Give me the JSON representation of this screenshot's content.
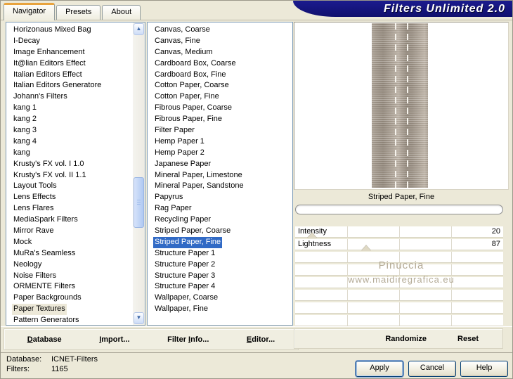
{
  "window_title": "Filters Unlimited 2.0",
  "tabs": [
    "Navigator",
    "Presets",
    "About"
  ],
  "active_tab": "Navigator",
  "category_list": {
    "selected": "Paper Textures",
    "items": [
      "Horizonaus Mixed Bag",
      "I-Decay",
      "Image Enhancement",
      "It@lian Editors Effect",
      "Italian Editors Effect",
      "Italian Editors Generatore",
      "Johann's Filters",
      "kang 1",
      "kang 2",
      "kang 3",
      "kang 4",
      "kang",
      "Krusty's FX vol. I 1.0",
      "Krusty's FX vol. II 1.1",
      "Layout Tools",
      "Lens Effects",
      "Lens Flares",
      "MediaSpark Filters",
      "Mirror Rave",
      "Mock",
      "MuRa's Seamless",
      "Neology",
      "Noise Filters",
      "ORMENTE Filters",
      "Paper Backgrounds",
      "Paper Textures",
      "Pattern Generators"
    ]
  },
  "filter_list": {
    "selected": "Striped Paper, Fine",
    "items": [
      "Canvas, Coarse",
      "Canvas, Fine",
      "Canvas, Medium",
      "Cardboard Box, Coarse",
      "Cardboard Box, Fine",
      "Cotton Paper, Coarse",
      "Cotton Paper, Fine",
      "Fibrous Paper, Coarse",
      "Fibrous Paper, Fine",
      "Filter Paper",
      "Hemp Paper 1",
      "Hemp Paper 2",
      "Japanese Paper",
      "Mineral Paper, Limestone",
      "Mineral Paper, Sandstone",
      "Papyrus",
      "Rag Paper",
      "Recycling Paper",
      "Striped Paper, Coarse",
      "Striped Paper, Fine",
      "Structure Paper 1",
      "Structure Paper 2",
      "Structure Paper 3",
      "Structure Paper 4",
      "Wallpaper, Coarse",
      "Wallpaper, Fine"
    ]
  },
  "preview": {
    "caption": "Striped Paper, Fine"
  },
  "sliders": [
    {
      "label": "Intensity",
      "value": "20",
      "track_percent": 8
    },
    {
      "label": "Lightness",
      "value": "87",
      "track_percent": 34
    }
  ],
  "empty_slider_rows": 6,
  "watermark": {
    "line1": "Pinuccia",
    "line2": "www.maidiregrafica.eu"
  },
  "command_buttons": {
    "left": [
      {
        "label": "Database",
        "mnemonic_index": 0
      },
      {
        "label": "Import...",
        "mnemonic_index": 0
      },
      {
        "label": "Filter Info...",
        "mnemonic_index": 7
      },
      {
        "label": "Editor...",
        "mnemonic_index": 0
      }
    ],
    "right": [
      {
        "label": "Randomize",
        "mnemonic_index": -1
      },
      {
        "label": "Reset",
        "mnemonic_index": -1
      }
    ]
  },
  "status": {
    "database_label": "Database:",
    "database_value": "ICNET-Filters",
    "filters_label": "Filters:",
    "filters_value": "1165"
  },
  "dialog_buttons": {
    "apply": "Apply",
    "cancel": "Cancel",
    "help": "Help"
  },
  "icons": {
    "scroll_up": "▲",
    "scroll_down": "▼"
  },
  "colors": {
    "selection_active": "#316AC5",
    "selection_inactive": "#ECE8D8",
    "title_background": "#12127E",
    "tab_accent": "#E8A33D",
    "dialog_background": "#ECE9D8"
  }
}
